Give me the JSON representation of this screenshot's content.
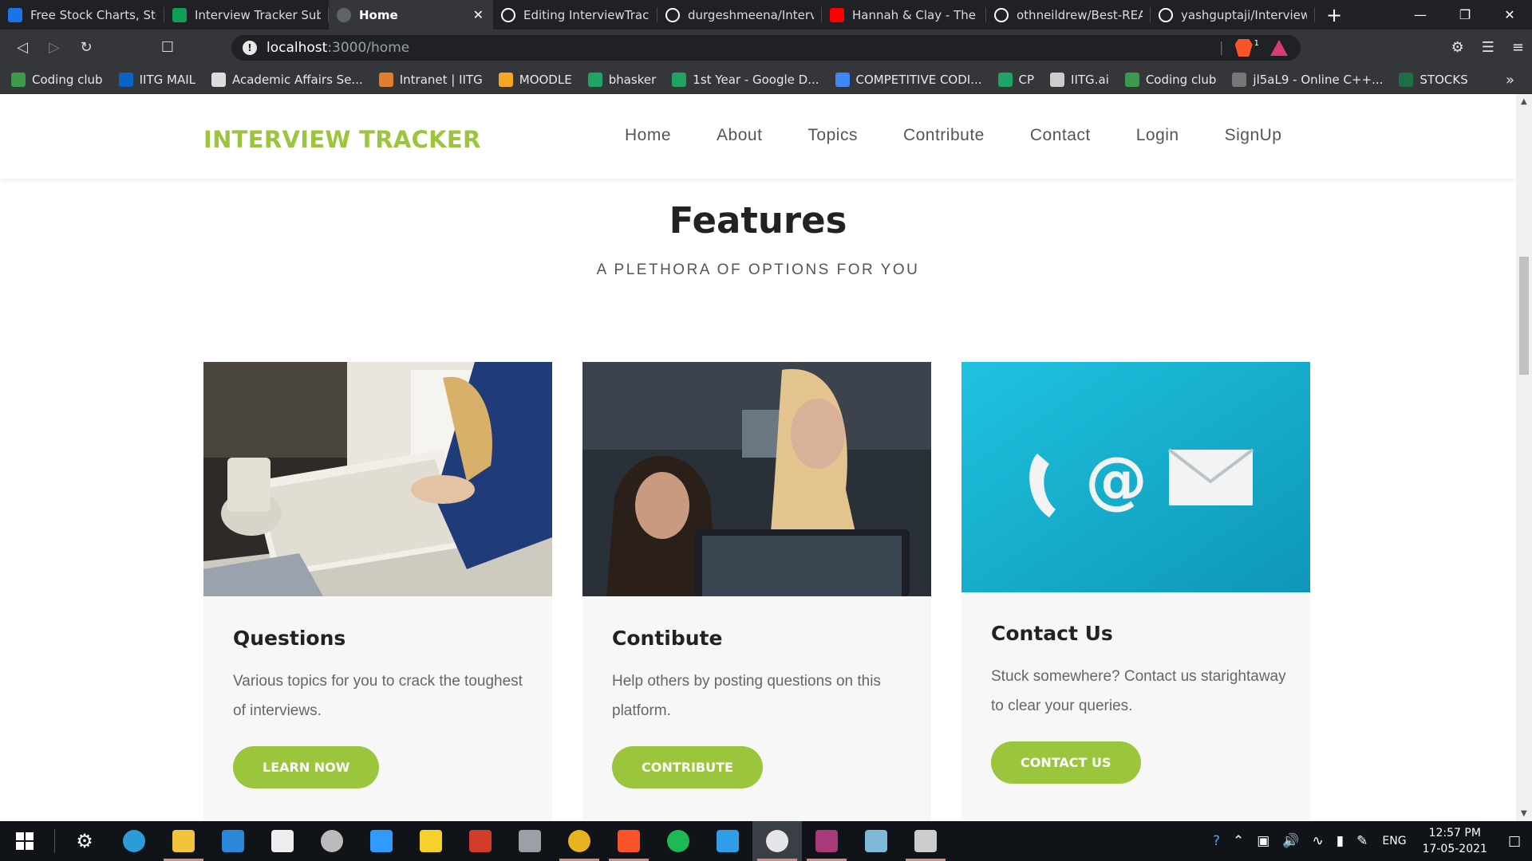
{
  "browser": {
    "tabs": [
      {
        "label": "Free Stock Charts, Stock",
        "icon_color": "#1a73e8",
        "active": false,
        "icon": "chart-icon"
      },
      {
        "label": "Interview Tracker Submi",
        "icon_color": "#0f9d58",
        "active": false,
        "icon": "sheets-icon"
      },
      {
        "label": "Home",
        "icon_color": "#5f6368",
        "active": true,
        "icon": "globe-icon"
      },
      {
        "label": "Editing InterviewTracker",
        "icon_color": "#ffffff",
        "active": false,
        "icon": "github-icon"
      },
      {
        "label": "durgeshmeena/Intervie",
        "icon_color": "#ffffff",
        "active": false,
        "icon": "github-icon"
      },
      {
        "label": "Hannah & Clay - The",
        "icon_color": "#ff0000",
        "active": false,
        "icon": "youtube-icon"
      },
      {
        "label": "othneildrew/Best-READ",
        "icon_color": "#ffffff",
        "active": false,
        "icon": "github-icon"
      },
      {
        "label": "yashguptaji/InterviewTra",
        "icon_color": "#ffffff",
        "active": false,
        "icon": "github-icon"
      }
    ],
    "address": {
      "host": "localhost",
      "path": ":3000/home"
    },
    "brave_badge": "1",
    "bookmarks": [
      {
        "label": "Coding club",
        "color": "#3c9a4a"
      },
      {
        "label": "IITG MAIL",
        "color": "#0a64c8"
      },
      {
        "label": "Academic Affairs Se...",
        "color": "#dddddd"
      },
      {
        "label": "Intranet | IITG",
        "color": "#e0802c"
      },
      {
        "label": "MOODLE",
        "color": "#f5a623"
      },
      {
        "label": "bhasker",
        "color": "#1fa463"
      },
      {
        "label": "1st Year - Google D...",
        "color": "#1fa463"
      },
      {
        "label": "COMPETITIVE CODI...",
        "color": "#4285f4"
      },
      {
        "label": "CP",
        "color": "#1fa463"
      },
      {
        "label": "IITG.ai",
        "color": "#cccccc"
      },
      {
        "label": "Coding club",
        "color": "#3c9a4a"
      },
      {
        "label": "jl5aL9 - Online C++...",
        "color": "#777777"
      },
      {
        "label": "STOCKS",
        "color": "#1d7044"
      }
    ],
    "bookmarks_more": "»"
  },
  "site": {
    "logo": "INTERVIEW TRACKER",
    "accent": "#9bc53d",
    "nav": [
      "Home",
      "About",
      "Topics",
      "Contribute",
      "Contact",
      "Login",
      "SignUp"
    ],
    "features_title": "Features",
    "features_subtitle": "A PLETHORA OF OPTIONS FOR YOU",
    "cards": [
      {
        "title": "Questions",
        "text": "Various topics for you to crack the toughest of interviews.",
        "button": "LEARN NOW"
      },
      {
        "title": "Contibute",
        "text": "Help others by posting questions on this platform.",
        "button": "CONTRIBUTE"
      },
      {
        "title": "Contact Us",
        "text": "Stuck somewhere? Contact us starightaway to clear your queries.",
        "button": "CONTACT US"
      }
    ]
  },
  "taskbar": {
    "apps": [
      {
        "name": "settings-icon",
        "color": "#ffffff"
      },
      {
        "name": "edge-icon",
        "color": "#2c9bd8"
      },
      {
        "name": "file-explorer-icon",
        "color": "#f3c33c"
      },
      {
        "name": "mail-icon",
        "color": "#2b88d8"
      },
      {
        "name": "store-icon",
        "color": "#eeeeee"
      },
      {
        "name": "clock-app-icon",
        "color": "#bbbbbb"
      },
      {
        "name": "power-automate-icon",
        "color": "#2f9bff"
      },
      {
        "name": "sticky-notes-icon",
        "color": "#f6d12c"
      },
      {
        "name": "office-icon",
        "color": "#d33c2b"
      },
      {
        "name": "snip-icon",
        "color": "#9aa0a6"
      },
      {
        "name": "chrome-icon",
        "color": "#e8b221"
      },
      {
        "name": "brave-icon",
        "color": "#fb542b"
      },
      {
        "name": "spotify-icon",
        "color": "#1db954"
      },
      {
        "name": "vscode-icon",
        "color": "#2f9de8"
      },
      {
        "name": "steam-icon",
        "color": "#e6e6e6"
      },
      {
        "name": "winrar-icon",
        "color": "#a83a7a"
      },
      {
        "name": "notepad-icon",
        "color": "#7fb8d8"
      },
      {
        "name": "terminal-icon",
        "color": "#cccccc"
      }
    ],
    "lang": "ENG",
    "time": "12:57 PM",
    "date": "17-05-2021"
  }
}
